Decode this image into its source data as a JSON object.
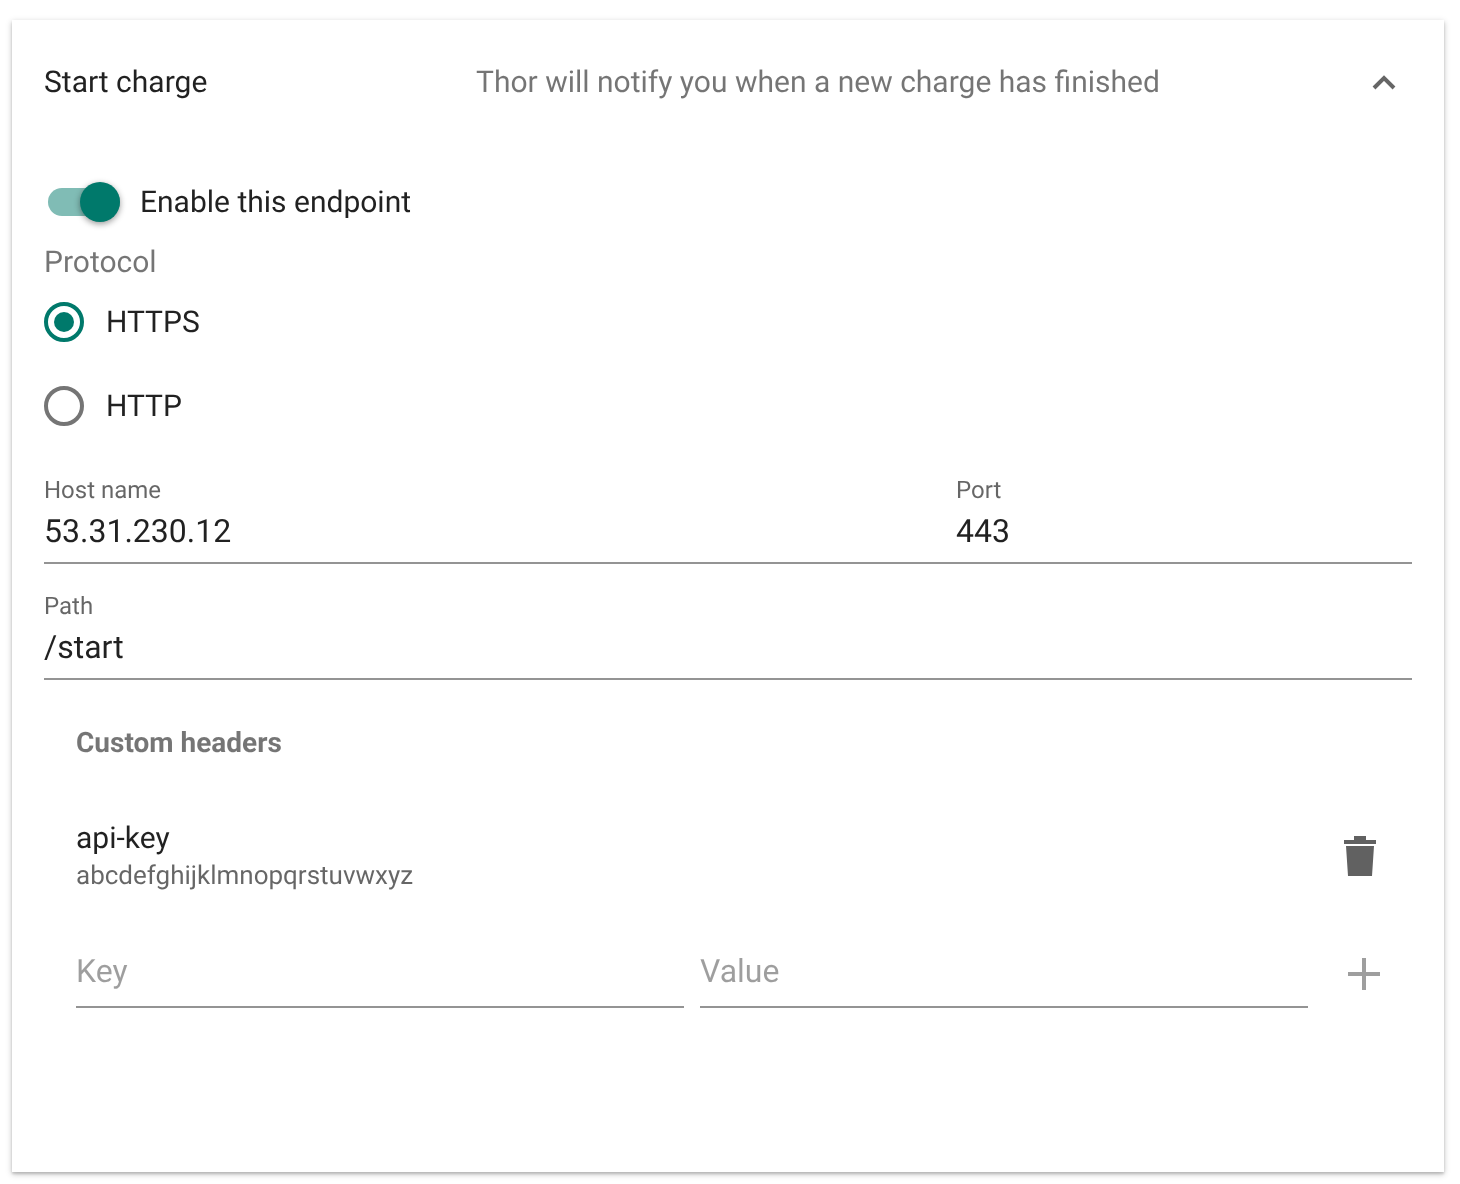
{
  "panel": {
    "title": "Start charge",
    "description": "Thor will notify you when a new charge has finished",
    "expanded": true
  },
  "enable_toggle": {
    "label": "Enable this endpoint",
    "on": true
  },
  "protocol": {
    "label": "Protocol",
    "options": [
      {
        "label": "HTTPS",
        "selected": true
      },
      {
        "label": "HTTP",
        "selected": false
      }
    ]
  },
  "host_name": {
    "label": "Host name",
    "value": "53.31.230.12"
  },
  "port": {
    "label": "Port",
    "value": "443"
  },
  "path": {
    "label": "Path",
    "value": "/start"
  },
  "custom_headers": {
    "title": "Custom headers",
    "items": [
      {
        "key": "api-key",
        "value": "abcdefghijklmnopqrstuvwxyz"
      }
    ],
    "key_field": {
      "placeholder": "Key"
    },
    "value_field": {
      "placeholder": "Value"
    }
  }
}
